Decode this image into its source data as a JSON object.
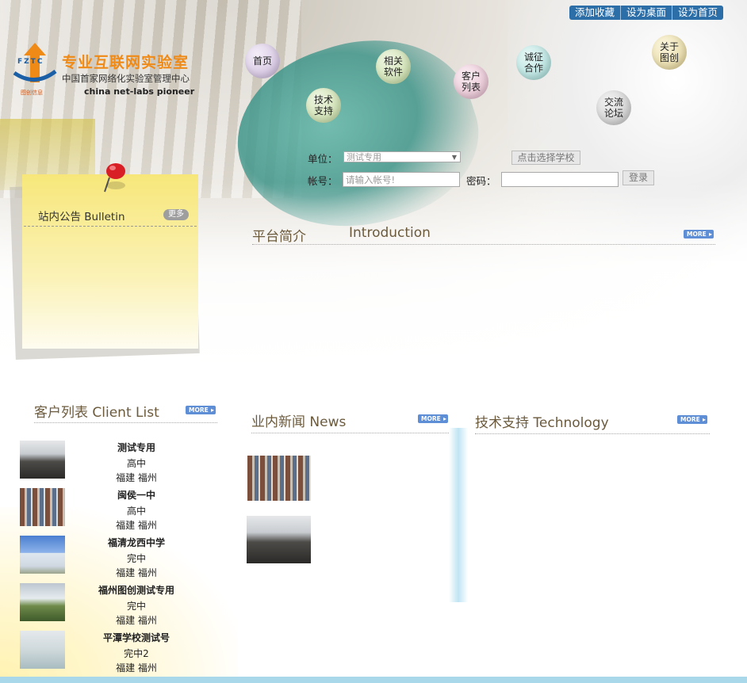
{
  "top_links": [
    "添加收藏",
    "设为桌面",
    "设为首页"
  ],
  "logo": {
    "mark_text": "FZTC",
    "mark_sub": "图创信息",
    "title": "专业互联网实验室",
    "subtitle": "中国首家网络化实验室管理中心",
    "english": "china net-labs pioneer"
  },
  "nav": {
    "home": "首页",
    "software": "相关软件",
    "clients": "客户列表",
    "cooperation": "诚征合作",
    "tech": "技术支持",
    "forum": "交流论坛",
    "about": "关于图创"
  },
  "login": {
    "unit_label": "单位：",
    "unit_value": "测试专用",
    "choose_school": "点击选择学校",
    "account_label": "帐号：",
    "account_placeholder": "请输入帐号!",
    "password_label": "密码：",
    "login_button": "登录"
  },
  "bulletin": {
    "title": "站内公告  Bulletin",
    "more": "更多"
  },
  "sections": {
    "intro": {
      "cn": "平台简介",
      "en": "Introduction",
      "more": "MORE"
    },
    "clients": {
      "title": "客户列表  Client List",
      "more": "MORE"
    },
    "news": {
      "title": "业内新闻  News",
      "more": "MORE"
    },
    "tech": {
      "title": "技术支持  Technology",
      "more": "MORE"
    }
  },
  "client_list": [
    {
      "name": "测试专用",
      "type": "高中",
      "location": "福建  福州"
    },
    {
      "name": "闽侯一中",
      "type": "高中",
      "location": "福建  福州"
    },
    {
      "name": "福清龙西中学",
      "type": "完中",
      "location": "福建  福州"
    },
    {
      "name": "福州图创测试专用",
      "type": "完中",
      "location": "福建  福州"
    },
    {
      "name": "平潭学校测试号",
      "type": "完中2",
      "location": "福建  福州"
    }
  ],
  "colors": {
    "accent_orange": "#f08a16",
    "link_blue": "#2c6ea8",
    "more_blue": "#5e8ed6",
    "section_text": "#6b5a3c"
  }
}
